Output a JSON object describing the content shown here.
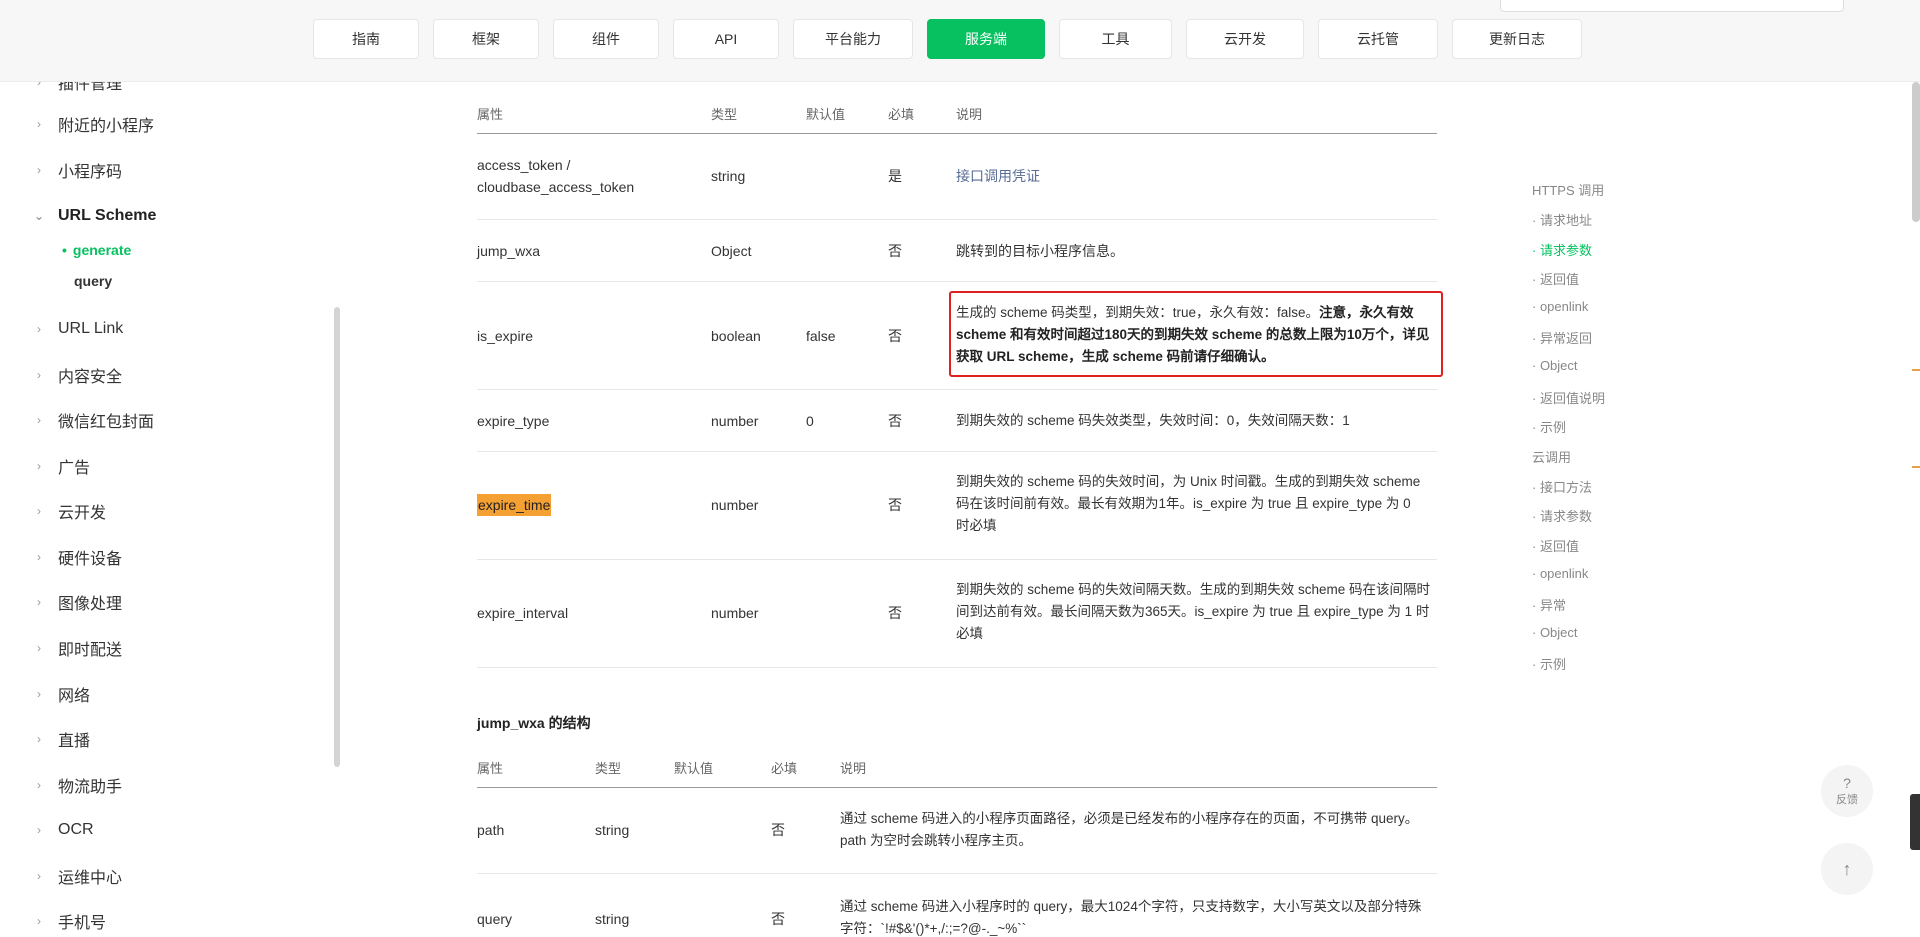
{
  "nav": {
    "items": [
      "指南",
      "框架",
      "组件",
      "API",
      "平台能力",
      "服务端",
      "工具",
      "云开发",
      "云托管",
      "更新日志"
    ],
    "active": "服务端"
  },
  "sidebar": {
    "items": [
      "插件管理",
      "附近的小程序",
      "小程序码",
      "URL Scheme",
      "URL Link",
      "内容安全",
      "微信红包封面",
      "广告",
      "云开发",
      "硬件设备",
      "图像处理",
      "即时配送",
      "网络",
      "直播",
      "物流助手",
      "OCR",
      "运维中心",
      "手机号"
    ],
    "expanded": "URL Scheme",
    "subitems": [
      "generate",
      "query"
    ],
    "active_sub": "generate"
  },
  "params_table": {
    "headers": [
      "属性",
      "类型",
      "默认值",
      "必填",
      "说明"
    ],
    "rows": [
      {
        "name": "access_token / cloudbase_access_token",
        "type": "string",
        "default": "",
        "required": "是",
        "desc": "接口调用凭证"
      },
      {
        "name": "jump_wxa",
        "type": "Object",
        "default": "",
        "required": "否",
        "desc": "跳转到的目标小程序信息。"
      },
      {
        "name": "is_expire",
        "type": "boolean",
        "default": "false",
        "required": "否",
        "desc_plain": "生成的 scheme 码类型，到期失效：true，永久有效：false。",
        "desc_bold1": "注意，永久有效 scheme 和有效时间超过180天的到期失效 scheme 的总数上限为10万个，详见",
        "desc_link": "获取 URL scheme",
        "desc_bold2": "，生成 scheme 码前请仔细确认。"
      },
      {
        "name": "expire_type",
        "type": "number",
        "default": "0",
        "required": "否",
        "desc": "到期失效的 scheme 码失效类型，失效时间：0，失效间隔天数：1"
      },
      {
        "name": "expire_time",
        "type": "number",
        "default": "",
        "required": "否",
        "desc": "到期失效的 scheme 码的失效时间，为 Unix 时间戳。生成的到期失效 scheme 码在该时间前有效。最长有效期为1年。is_expire 为 true 且 expire_type 为 0 时必填"
      },
      {
        "name": "expire_interval",
        "type": "number",
        "default": "",
        "required": "否",
        "desc": "到期失效的 scheme 码的失效间隔天数。生成的到期失效 scheme 码在该间隔时间到达前有效。最长间隔天数为365天。is_expire 为 true 且 expire_type 为 1 时必填"
      }
    ]
  },
  "jump_wxa_section": {
    "title": "jump_wxa 的结构",
    "headers": [
      "属性",
      "类型",
      "默认值",
      "必填",
      "说明"
    ],
    "rows": [
      {
        "name": "path",
        "type": "string",
        "default": "",
        "required": "否",
        "desc": "通过 scheme 码进入的小程序页面路径，必须是已经发布的小程序存在的页面，不可携带 query。path 为空时会跳转小程序主页。"
      },
      {
        "name": "query",
        "type": "string",
        "default": "",
        "required": "否",
        "desc": "通过 scheme 码进入小程序时的 query，最大1024个字符，只支持数字，大小写英文以及部分特殊字符：`!#$&'()*+,/:;=?@-._~%``"
      }
    ]
  },
  "toc": {
    "items": [
      {
        "label": "HTTPS 调用",
        "level": 0
      },
      {
        "label": "· 请求地址",
        "level": 1
      },
      {
        "label": "· 请求参数",
        "level": 1,
        "active": true
      },
      {
        "label": "· 返回值",
        "level": 1
      },
      {
        "label": "· openlink",
        "level": 1
      },
      {
        "label": "· 异常返回",
        "level": 1
      },
      {
        "label": "· Object",
        "level": 1
      },
      {
        "label": "· 返回值说明",
        "level": 1
      },
      {
        "label": "· 示例",
        "level": 1
      },
      {
        "label": "云调用",
        "level": 0
      },
      {
        "label": "· 接口方法",
        "level": 1
      },
      {
        "label": "· 请求参数",
        "level": 1
      },
      {
        "label": "· 返回值",
        "level": 1
      },
      {
        "label": "· openlink",
        "level": 1
      },
      {
        "label": "· 异常",
        "level": 1
      },
      {
        "label": "· Object",
        "level": 1
      },
      {
        "label": "· 示例",
        "level": 1
      }
    ]
  },
  "float": {
    "feedback_glyph": "?",
    "feedback_label": "反馈",
    "top_glyph": "↑"
  },
  "colors": {
    "accent": "#07c160",
    "highlight": "#f5a033",
    "link": "#576b95",
    "alert_border": "#e02020"
  }
}
